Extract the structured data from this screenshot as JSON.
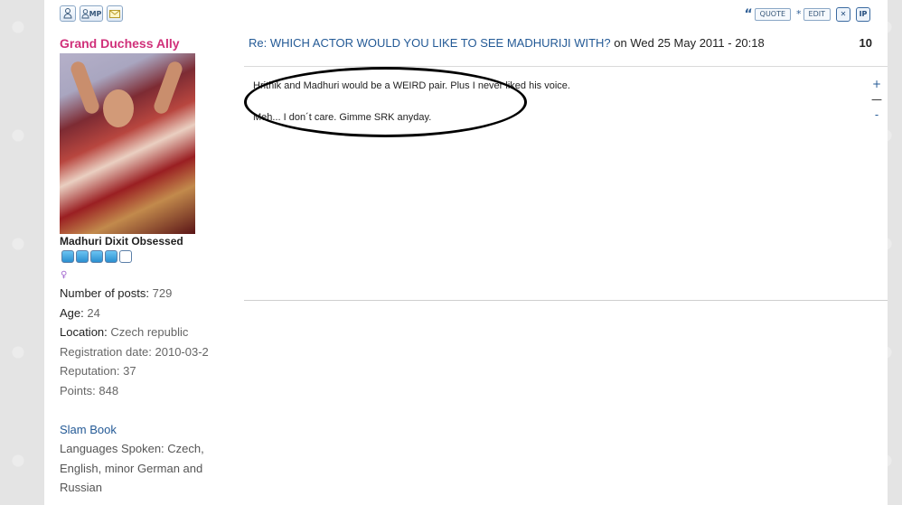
{
  "toolbar": {
    "profile_icon": "profile-icon",
    "pm_label": "MP",
    "email_icon": "email-icon",
    "quote_label": "QUOTE",
    "edit_label": "EDIT",
    "delete_label": "✕",
    "ip_label": "IP"
  },
  "user": {
    "name": "Grand Duchess Ally",
    "rank": "Madhuri Dixit Obsessed",
    "rank_pips_filled": 4,
    "rank_pips_total": 5,
    "gender_symbol": "♀",
    "posts_label": "Number of posts",
    "posts_value": "729",
    "age_label": "Age",
    "age_value": "24",
    "location_label": "Location",
    "location_value": "Czech republic",
    "registration_label": "Registration date",
    "registration_value": "2010-03-2",
    "reputation_label": "Reputation",
    "reputation_value": "37",
    "points_label": "Points",
    "points_value": "848",
    "slam_book": "Slam Book",
    "languages": "Languages Spoken: Czech, English, minor German and Russian"
  },
  "post": {
    "title": "Re: WHICH ACTOR WOULD YOU LIKE TO SEE MADHURIJI WITH?",
    "date": " on Wed 25 May 2011 - 20:18",
    "number": "10",
    "line1": "Hrithik and Madhuri would be a WEIRD pair. Plus I never liked his voice.",
    "line2": "Meh... I don´t care. Gimme SRK anyday.",
    "vote_plus": "+",
    "vote_minus": "-"
  }
}
